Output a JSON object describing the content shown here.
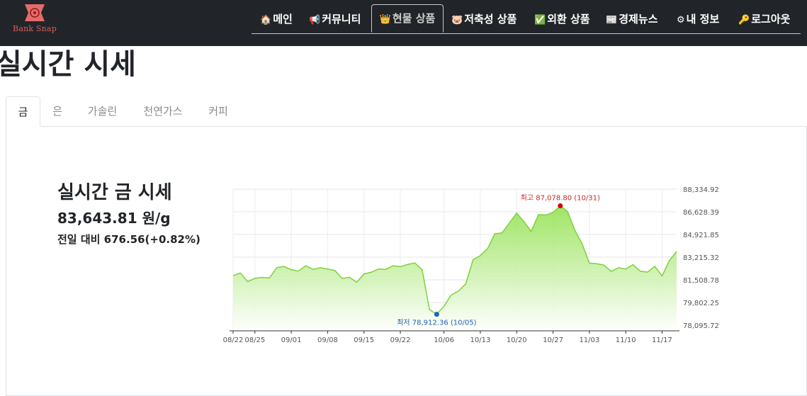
{
  "header": {
    "logo_text": "Bank Snap",
    "nav": [
      {
        "label": "메인",
        "icon": "🏠",
        "icon_name": "home-icon"
      },
      {
        "label": "커뮤니티",
        "icon": "📢",
        "icon_name": "megaphone-icon"
      },
      {
        "label": "현물 상품",
        "icon": "👑",
        "icon_name": "crown-icon",
        "active": true
      },
      {
        "label": "저축성 상품",
        "icon": "🐷",
        "icon_name": "pig-icon"
      },
      {
        "label": "외환 상품",
        "icon": "✅",
        "icon_name": "check-icon"
      },
      {
        "label": "경제뉴스",
        "icon": "📰",
        "icon_name": "newspaper-icon"
      },
      {
        "label": "내 정보",
        "icon": "⚙",
        "icon_name": "gear-icon"
      },
      {
        "label": "로그아웃",
        "icon": "🔑",
        "icon_name": "key-icon"
      }
    ]
  },
  "page": {
    "title": "실시간 시세"
  },
  "tabs": [
    "금",
    "은",
    "가솔린",
    "천연가스",
    "커피"
  ],
  "summary": {
    "title": "실시간 금 시세",
    "price": "83,643.81 원/g",
    "change": "전일 대비 676.56(+0.82%)"
  },
  "chart_data": {
    "type": "area",
    "colors": {
      "line": "#7fd13b",
      "fill_top": "#8fe04a",
      "fill_bottom": "#ffffff",
      "max": "#d50000",
      "min": "#1565c0"
    },
    "ylim": [
      78095.72,
      88334.92
    ],
    "y_ticks": [
      "88,334.92",
      "86,628.39",
      "84,921.85",
      "83,215.32",
      "81,508.78",
      "79,802.25",
      "78,095.72"
    ],
    "x_tick_labels": [
      "08/22",
      "08/25",
      "09/01",
      "09/08",
      "09/15",
      "09/22",
      "10/06",
      "10/13",
      "10/20",
      "10/27",
      "11/03",
      "11/10",
      "11/17"
    ],
    "x_tick_index": [
      0,
      3,
      8,
      13,
      18,
      23,
      29,
      34,
      39,
      44,
      49,
      54,
      59
    ],
    "grid": true,
    "max_label": "최고 87,078.80 (10/31)",
    "min_label": "최저 78,912.36 (10/05)",
    "max_index": 45,
    "min_index": 28,
    "values": [
      81820,
      82020,
      81370,
      81620,
      81690,
      81650,
      82420,
      82520,
      82270,
      82170,
      82570,
      82290,
      82420,
      82320,
      82210,
      81610,
      81700,
      81330,
      81950,
      82080,
      82330,
      82290,
      82570,
      82500,
      82670,
      82780,
      82270,
      79270,
      78912.36,
      79520,
      80370,
      80670,
      81200,
      83030,
      83330,
      83860,
      84980,
      85050,
      85790,
      86530,
      85900,
      85150,
      86420,
      86390,
      86580,
      87078.8,
      86650,
      85250,
      84220,
      82770,
      82720,
      82620,
      82150,
      82420,
      82330,
      82650,
      82160,
      82090,
      82520,
      81800,
      82960,
      83643.81
    ]
  }
}
